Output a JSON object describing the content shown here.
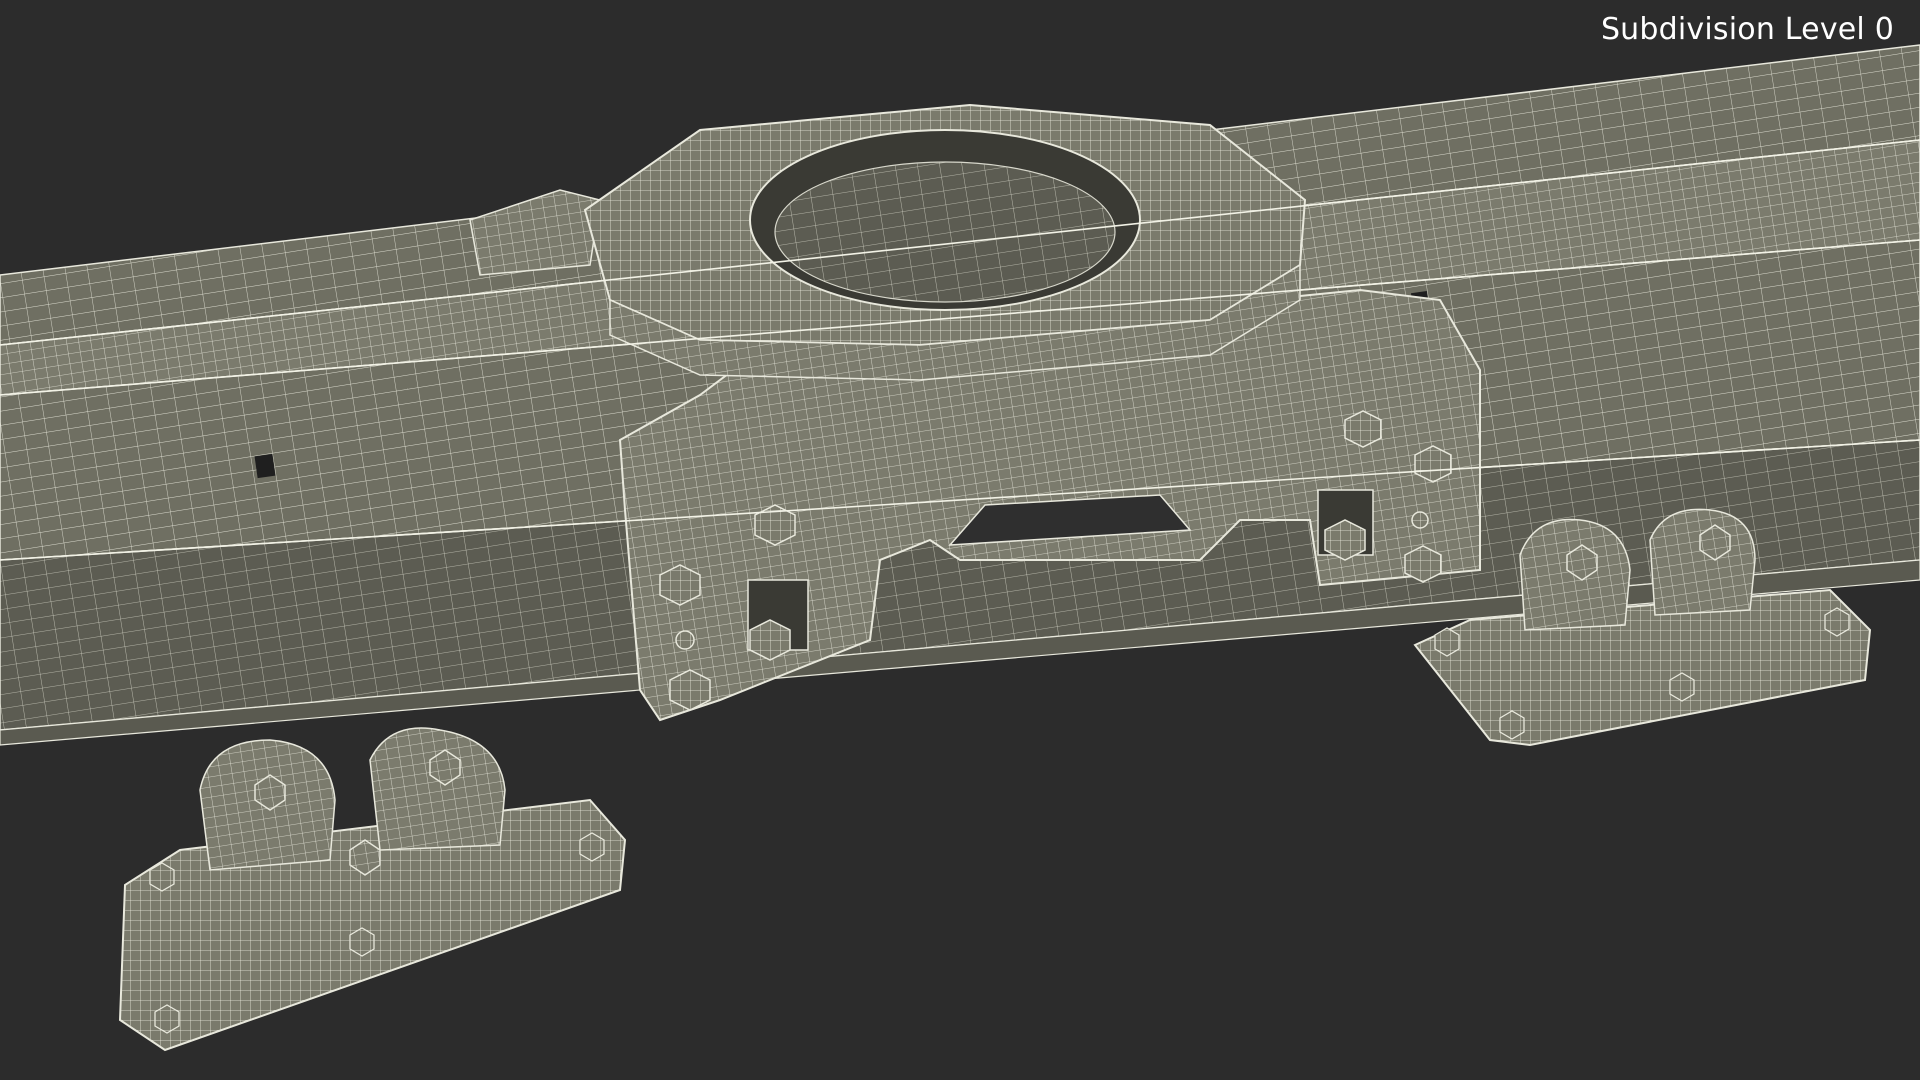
{
  "viewport": {
    "subdivision_label": "Subdivision Level 0",
    "background_color": "#2c2c2c",
    "mesh_fill_color": "#737366",
    "wire_color": "#e8e8dc"
  }
}
